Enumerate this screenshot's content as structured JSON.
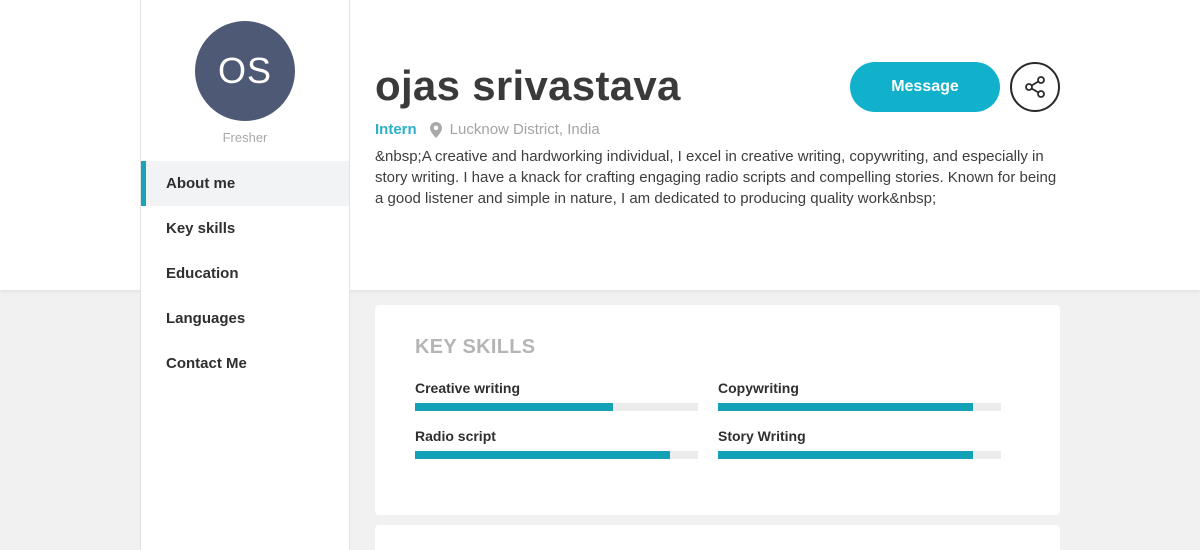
{
  "profile": {
    "initials": "OS",
    "status": "Fresher",
    "name": "ojas srivastava",
    "role": "Intern",
    "location": "Lucknow District, India",
    "bio": "&nbsp;A creative and hardworking individual, I excel in creative writing, copywriting, and especially in story writing. I have a knack for crafting engaging radio scripts and compelling stories. Known for being a good listener and simple in nature, I am dedicated to producing quality work&nbsp;"
  },
  "actions": {
    "message_label": "Message",
    "share_icon": "share-icon"
  },
  "nav": {
    "items": [
      {
        "label": "About me",
        "active": true
      },
      {
        "label": "Key skills",
        "active": false
      },
      {
        "label": "Education",
        "active": false
      },
      {
        "label": "Languages",
        "active": false
      },
      {
        "label": "Contact Me",
        "active": false
      }
    ]
  },
  "skills": {
    "title": "KEY SKILLS",
    "items": [
      {
        "label": "Creative writing",
        "level": 0.7
      },
      {
        "label": "Copywriting",
        "level": 0.9
      },
      {
        "label": "Radio script",
        "level": 0.9
      },
      {
        "label": "Story Writing",
        "level": 0.9
      }
    ]
  },
  "colors": {
    "accent": "#11b1cc",
    "skill_bar": "#12a1b6",
    "avatar_bg": "#4d5975",
    "role_text": "#2bb0c8"
  }
}
